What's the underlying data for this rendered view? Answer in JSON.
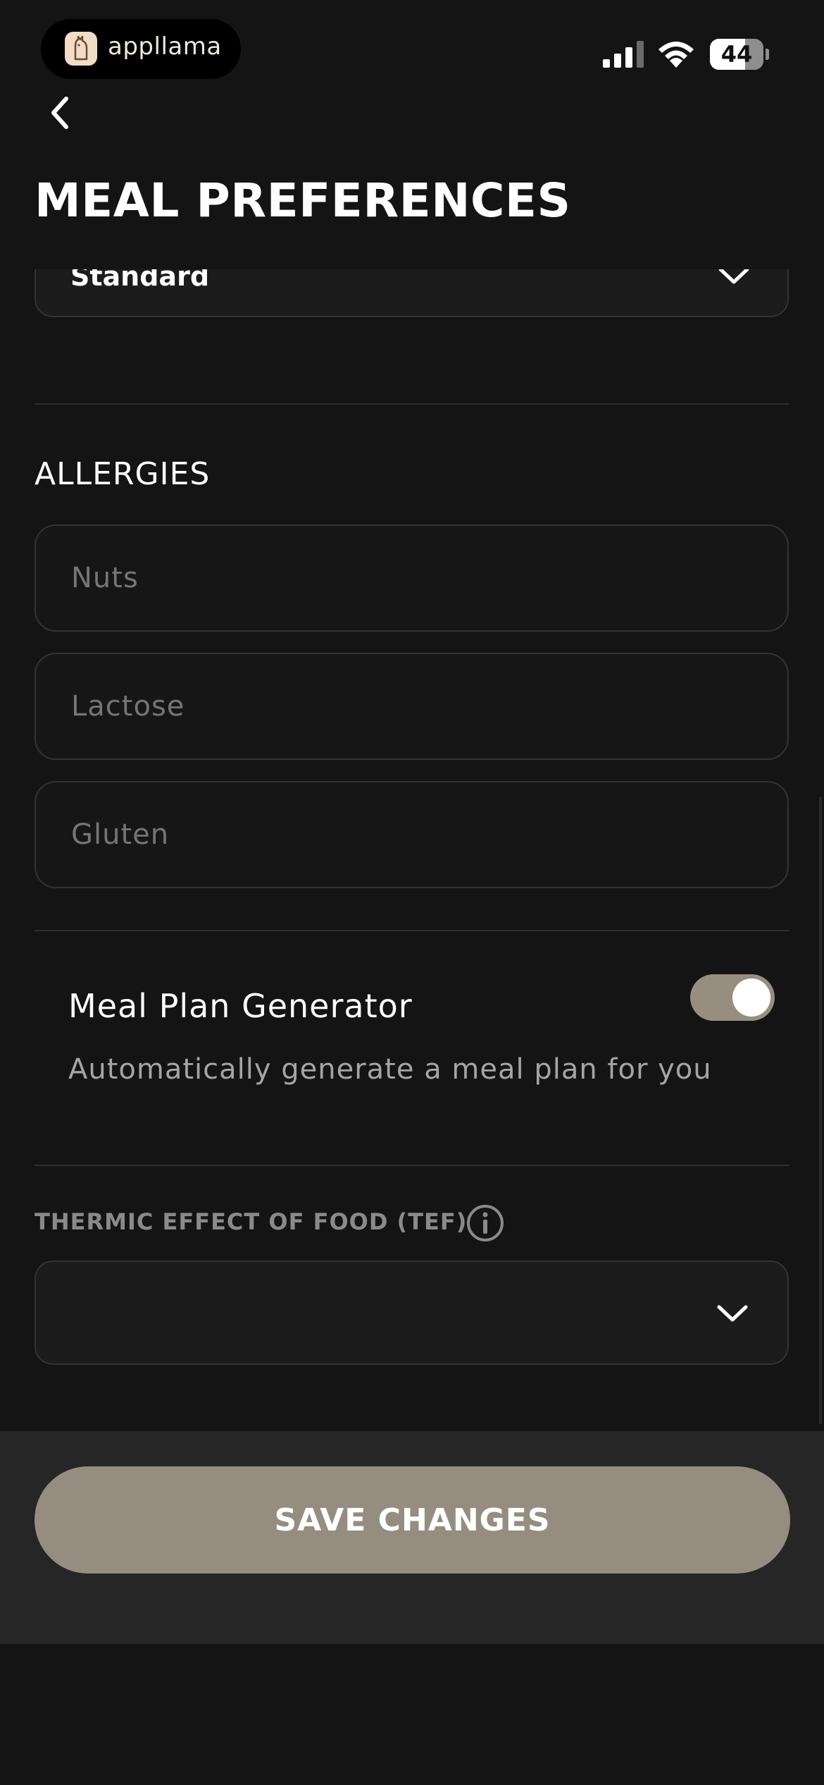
{
  "status_bar": {
    "app_name": "appllama",
    "battery_level": "44",
    "icons": [
      "signal-icon",
      "wifi-icon",
      "battery-icon"
    ]
  },
  "header": {
    "title": "MEAL PREFERENCES",
    "back_icon": "chevron-left-icon"
  },
  "diet_type": {
    "value": "Standard"
  },
  "allergies": {
    "title": "ALLERGIES",
    "items": [
      {
        "placeholder": "Nuts"
      },
      {
        "placeholder": "Lactose"
      },
      {
        "placeholder": "Gluten"
      }
    ]
  },
  "meal_plan_generator": {
    "label": "Meal Plan Generator",
    "description": "Automatically generate a meal plan for you",
    "enabled": true
  },
  "tef": {
    "label": "THERMIC EFFECT OF FOOD (TEF)",
    "value": "",
    "info_icon": "info-icon"
  },
  "footer": {
    "save_label": "SAVE CHANGES"
  },
  "colors": {
    "background": "#141414",
    "accent": "#958d80",
    "toggle_on": "#978e80",
    "footer": "#262626"
  }
}
